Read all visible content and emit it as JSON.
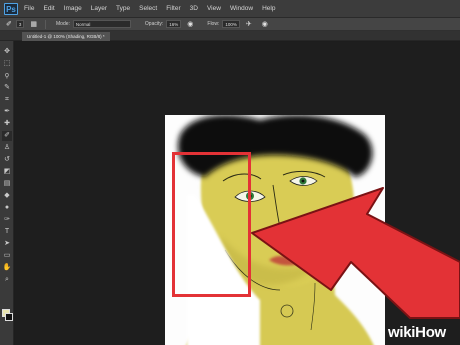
{
  "app": {
    "logo_text": "Ps"
  },
  "menu": {
    "items": [
      "File",
      "Edit",
      "Image",
      "Layer",
      "Type",
      "Select",
      "Filter",
      "3D",
      "View",
      "Window",
      "Help"
    ]
  },
  "options": {
    "brush_size": "3",
    "mode_label": "Mode:",
    "mode_value": "Normal",
    "opacity_label": "Opacity:",
    "opacity_value": "16%",
    "flow_label": "Flow:",
    "flow_value": "100%"
  },
  "document": {
    "tab_title": "Untitled-1 @ 100% (Shading, RGB/8) *"
  },
  "toolbox": {
    "tools": [
      {
        "name": "move-tool-icon",
        "glyph": "✥"
      },
      {
        "name": "marquee-tool-icon",
        "glyph": "⬚"
      },
      {
        "name": "lasso-tool-icon",
        "glyph": "ϙ"
      },
      {
        "name": "quick-select-tool-icon",
        "glyph": "✎"
      },
      {
        "name": "crop-tool-icon",
        "glyph": "⌗"
      },
      {
        "name": "eyedropper-tool-icon",
        "glyph": "✒"
      },
      {
        "name": "healing-brush-tool-icon",
        "glyph": "✚"
      },
      {
        "name": "brush-tool-icon",
        "glyph": "✐"
      },
      {
        "name": "clone-stamp-tool-icon",
        "glyph": "♙"
      },
      {
        "name": "history-brush-tool-icon",
        "glyph": "↺"
      },
      {
        "name": "eraser-tool-icon",
        "glyph": "◩"
      },
      {
        "name": "gradient-tool-icon",
        "glyph": "▤"
      },
      {
        "name": "blur-tool-icon",
        "glyph": "◆"
      },
      {
        "name": "dodge-tool-icon",
        "glyph": "●"
      },
      {
        "name": "pen-tool-icon",
        "glyph": "✑"
      },
      {
        "name": "type-tool-icon",
        "glyph": "T"
      },
      {
        "name": "path-select-tool-icon",
        "glyph": "➤"
      },
      {
        "name": "shape-tool-icon",
        "glyph": "▭"
      },
      {
        "name": "hand-tool-icon",
        "glyph": "✋"
      },
      {
        "name": "zoom-tool-icon",
        "glyph": "⌕"
      }
    ],
    "active_tool": "brush-tool-icon",
    "foreground_color": "#e8e4b0",
    "background_color": "#111111"
  },
  "annotations": {
    "highlight_color": "#e33236",
    "arrow_color": "#e33236"
  },
  "watermark": {
    "wiki": "wiki",
    "how": "How"
  }
}
